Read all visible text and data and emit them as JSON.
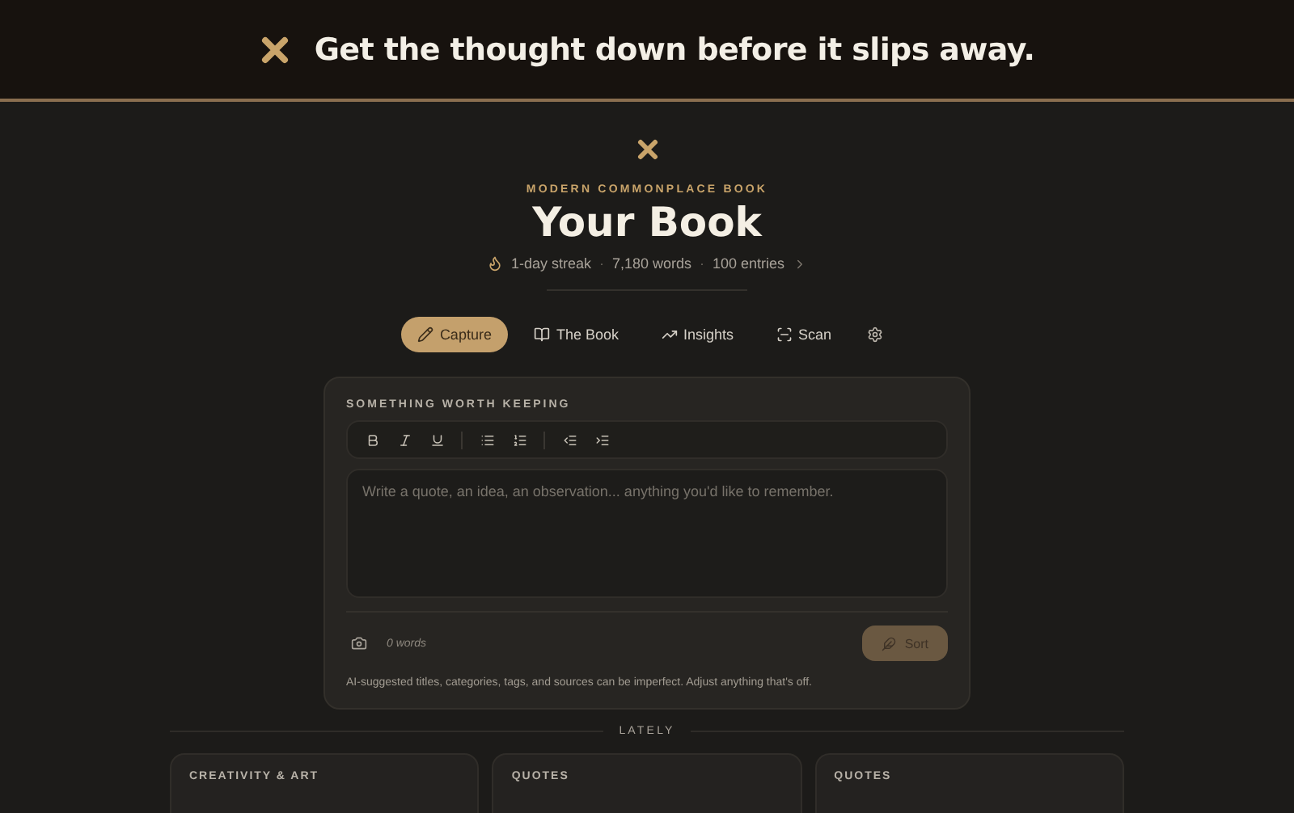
{
  "banner": {
    "headline": "Get the thought down before it slips away."
  },
  "hero": {
    "eyebrow": "MODERN COMMONPLACE BOOK",
    "title": "Your Book",
    "stats": [
      "1-day streak",
      "7,180 words",
      "100 entries"
    ],
    "separators": [
      "·",
      "·"
    ]
  },
  "tabs": [
    {
      "label": "Capture",
      "kind": "pencil",
      "selected": true
    },
    {
      "label": "The Book",
      "kind": "book",
      "selected": false
    },
    {
      "label": "Insights",
      "kind": "trend",
      "selected": false
    },
    {
      "label": "Scan",
      "kind": "scan",
      "selected": false
    }
  ],
  "composer": {
    "heading": "SOMETHING WORTH KEEPING",
    "placeholder": "Write a quote, an idea, an observation... anything you'd like to remember.",
    "word_count": "0 words",
    "sort_button": {
      "label": "Sort",
      "disabled": true
    },
    "disclaimer": "AI-suggested titles, categories, tags, and sources can be imperfect. Adjust anything that's off."
  },
  "lately": {
    "heading": "LATELY",
    "cards": [
      {
        "category": "CREATIVITY & ART"
      },
      {
        "category": "QUOTES"
      },
      {
        "category": "QUOTES"
      }
    ]
  }
}
